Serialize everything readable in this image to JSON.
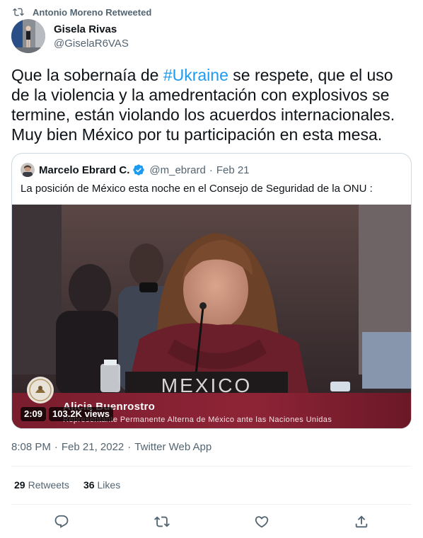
{
  "retweet": {
    "label": "Antonio Moreno Retweeted",
    "icon": "retweet-icon"
  },
  "author": {
    "name": "Gisela Rivas",
    "handle": "@GiselaR6VAS"
  },
  "tweet": {
    "text_before": "Que la sobernaía de ",
    "hashtag": "#Ukraine",
    "text_after": " se respete, que el uso de la violencia y la amedrentación con explosivos se termine, están violando los acuerdos internacionales. Muy bien México por tu participación en esta mesa.",
    "hashtag_color": "#1d9bf0"
  },
  "quote": {
    "name": "Marcelo Ebrard C.",
    "verified_icon": "verified-badge-icon",
    "handle": "@m_ebrard",
    "separator": "·",
    "date": "Feb 21",
    "text": "La posición de México esta noche en el Consejo de Seguridad de la ONU :",
    "video": {
      "placard": "MEXICO",
      "caption_name": "Alicia Buenrostro",
      "caption_title": "Representante Permanente Alterna de México ante las Naciones Unidas",
      "duration": "2:09",
      "views": "103.2K views"
    }
  },
  "meta": {
    "time": "8:08 PM",
    "separator": "·",
    "date": "Feb 21, 2022",
    "source": "Twitter Web App"
  },
  "stats": {
    "retweets_count": "29",
    "retweets_label": "Retweets",
    "likes_count": "36",
    "likes_label": "Likes"
  },
  "actions": [
    "reply-icon",
    "retweet-icon",
    "like-icon",
    "share-icon"
  ],
  "colors": {
    "secondary_text": "#536471",
    "link": "#1d9bf0",
    "border": "#cfd9de",
    "caption_band": "#7a1d2d"
  }
}
